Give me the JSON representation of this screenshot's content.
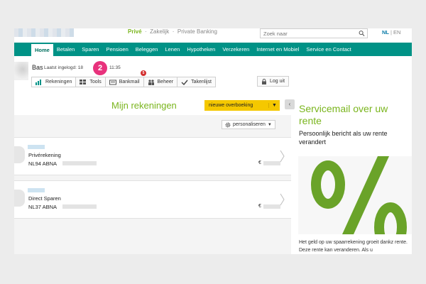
{
  "brand": {
    "prive": "Privé",
    "zakelijk": "Zakelijk",
    "private_banking": "Private Banking"
  },
  "search": {
    "placeholder": "Zoek naar"
  },
  "lang": {
    "nl": "NL",
    "sep": "|",
    "en": "EN"
  },
  "nav": [
    "Home",
    "Betalen",
    "Sparen",
    "Pensioen",
    "Beleggen",
    "Lenen",
    "Hypotheken",
    "Verzekeren",
    "Internet en Mobiel",
    "Service en Contact"
  ],
  "user": {
    "name": "Bas",
    "last_login": "Laatst ingelogd: 18",
    "time": "11:35",
    "step_badge": "2"
  },
  "tabs": [
    {
      "label": "Rekeningen",
      "icon": "bar-chart-icon"
    },
    {
      "label": "Tools",
      "icon": "grid-icon"
    },
    {
      "label": "Bankmail",
      "icon": "mail-icon"
    },
    {
      "label": "Beheer",
      "icon": "people-icon"
    },
    {
      "label": "Takenlijst",
      "icon": "check-icon"
    }
  ],
  "bankmail_count": "5",
  "logout": "Log uit",
  "main": {
    "title": "Mijn rekeningen",
    "new_transfer": "nieuwe overboeking",
    "personalize": "personaliseren",
    "accounts": [
      {
        "type": "Privérekening",
        "number": "NL94 ABNA",
        "currency": "€"
      },
      {
        "type": "Direct Sparen",
        "number": "NL37 ABNA",
        "currency": "€"
      }
    ]
  },
  "ad": {
    "title": "Servicemail over uw rente",
    "subtitle": "Persoonlijk bericht als uw rente verandert",
    "image_text": "%",
    "body": "Het geld op uw spaarrekening groeit dankz rente. Deze rente kan veranderen. Als u"
  },
  "colors": {
    "nav": "#009286",
    "green": "#7ab51d",
    "yellow": "#f5c800",
    "badge": "#e8327c"
  }
}
